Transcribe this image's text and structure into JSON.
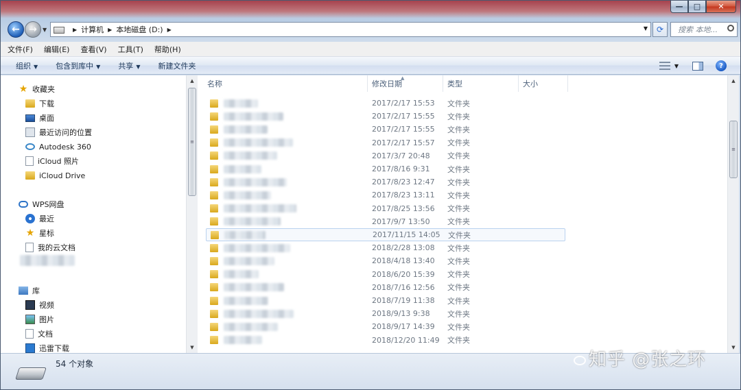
{
  "titlebar": {
    "min": "—",
    "max": "□",
    "close": "✕"
  },
  "address": {
    "crumbs": [
      "计算机",
      "本地磁盘 (D:)"
    ],
    "search_placeholder": "搜索 本地..."
  },
  "menu": [
    "文件(F)",
    "编辑(E)",
    "查看(V)",
    "工具(T)",
    "帮助(H)"
  ],
  "toolbar": {
    "organize": "组织",
    "include_library": "包含到库中",
    "share": "共享",
    "new_folder": "新建文件夹",
    "help": "?"
  },
  "nav": {
    "favorites": "收藏夹",
    "downloads": "下载",
    "desktop": "桌面",
    "recent_places": "最近访问的位置",
    "autodesk": "Autodesk 360",
    "icloud_photos": "iCloud 照片",
    "icloud_drive": "iCloud Drive",
    "wps": "WPS网盘",
    "wps_recent": "最近",
    "wps_star": "星标",
    "wps_docs": "我的云文档",
    "libraries": "库",
    "videos": "视频",
    "pictures": "图片",
    "documents": "文档",
    "xunlei": "迅雷下载"
  },
  "columns": {
    "name": "名称",
    "date": "修改日期",
    "type": "类型",
    "size": "大小"
  },
  "rows": [
    {
      "date": "2017/2/17 15:53",
      "type": "文件夹"
    },
    {
      "date": "2017/2/17 15:55",
      "type": "文件夹"
    },
    {
      "date": "2017/2/17 15:55",
      "type": "文件夹"
    },
    {
      "date": "2017/2/17 15:57",
      "type": "文件夹"
    },
    {
      "date": "2017/3/7 20:48",
      "type": "文件夹"
    },
    {
      "date": "2017/8/16 9:31",
      "type": "文件夹"
    },
    {
      "date": "2017/8/23 12:47",
      "type": "文件夹"
    },
    {
      "date": "2017/8/23 13:11",
      "type": "文件夹"
    },
    {
      "date": "2017/8/25 13:56",
      "type": "文件夹"
    },
    {
      "date": "2017/9/7 13:50",
      "type": "文件夹"
    },
    {
      "date": "2017/11/15 14:05",
      "type": "文件夹"
    },
    {
      "date": "2018/2/28 13:08",
      "type": "文件夹"
    },
    {
      "date": "2018/4/18 13:40",
      "type": "文件夹"
    },
    {
      "date": "2018/6/20 15:39",
      "type": "文件夹"
    },
    {
      "date": "2018/7/16 12:56",
      "type": "文件夹"
    },
    {
      "date": "2018/7/19 11:38",
      "type": "文件夹"
    },
    {
      "date": "2018/9/13 9:38",
      "type": "文件夹"
    },
    {
      "date": "2018/9/17 14:39",
      "type": "文件夹"
    },
    {
      "date": "2018/12/20 11:49",
      "type": "文件夹"
    }
  ],
  "selected_row": 10,
  "status": {
    "count": "54 个对象"
  },
  "watermark": "知乎 @张之环"
}
